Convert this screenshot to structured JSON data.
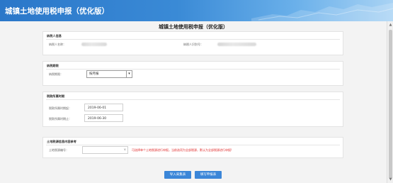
{
  "header": {
    "title": "城镇土地使用税申报（优化版）"
  },
  "page_title": "城镇土地使用税申报（优化版）",
  "taxpayer_info": {
    "section_title": "纳税人信息",
    "name_label": "纳税人名称：",
    "id_label": "纳税人识别号："
  },
  "deadline": {
    "section_title": "纳税期限",
    "label": "纳税期限：",
    "selected": "按月报"
  },
  "period": {
    "section_title": "税款所属时期",
    "start_label": "税款所属时期起：",
    "start_value": "2019-06-01",
    "end_label": "税款所属时期止：",
    "end_value": "2019-06-30"
  },
  "land_source": {
    "section_title": "土地税源信息内容参考",
    "label": "土地税源编号：",
    "warning": "可选择单个土地税源进行申报，当前选项为全部税源，默认为全部税源进行申报!"
  },
  "buttons": {
    "import": "导入采集表",
    "fill": "填写申报表"
  },
  "colors": {
    "header": "#2b77c9",
    "button": "#3b86d8",
    "warning": "#e02a2a"
  }
}
